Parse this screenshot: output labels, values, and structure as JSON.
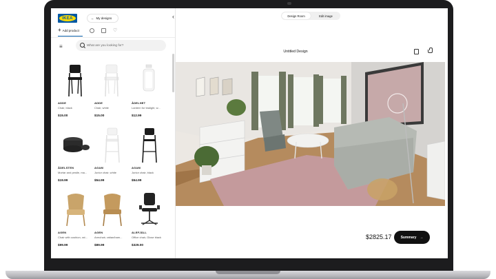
{
  "app": {
    "logo_text": "IKEA",
    "back_arrow": "←",
    "my_designs_label": "My designs",
    "collapse_icon": "‹"
  },
  "tabs": {
    "add_product_label": "Add product",
    "plus": "+",
    "favorite_icon": "♡"
  },
  "search": {
    "placeholder": "What are you looking for?",
    "menu_icon": "≡"
  },
  "products": [
    {
      "name": "ADDE",
      "desc": "Chair, black",
      "price": "$15.00"
    },
    {
      "name": "ADDE",
      "desc": "Chair, white",
      "price": "$15.00"
    },
    {
      "name": "ÅDELHET",
      "desc": "Lantern for tealight, w...",
      "price": "$12.99"
    },
    {
      "name": "ÅDELSTEN",
      "desc": "Mortar and pestle, ma...",
      "price": "$19.99"
    },
    {
      "name": "AGAM",
      "desc": "Junior chair, white",
      "price": "$54.99"
    },
    {
      "name": "AGAM",
      "desc": "Junior chair, black",
      "price": "$54.99"
    },
    {
      "name": "AGEN",
      "desc": "Chair with cushion, rat...",
      "price": "$99.99"
    },
    {
      "name": "AGEN",
      "desc": "Armchair, rattan/bam...",
      "price": "$89.99"
    },
    {
      "name": "ALEFJÄLL",
      "desc": "Office chair, Glose black",
      "price": "$329.00"
    }
  ],
  "view": {
    "tab_design_room": "Design Room",
    "tab_edit_image": "Edit image",
    "title": "Untitled Design"
  },
  "footer": {
    "total": "$2825.17",
    "summary_label": "Summary",
    "arrow": "→"
  },
  "colors": {
    "brand_blue": "#0058a3",
    "brand_yellow": "#ffdb00",
    "button_dark": "#111111"
  }
}
